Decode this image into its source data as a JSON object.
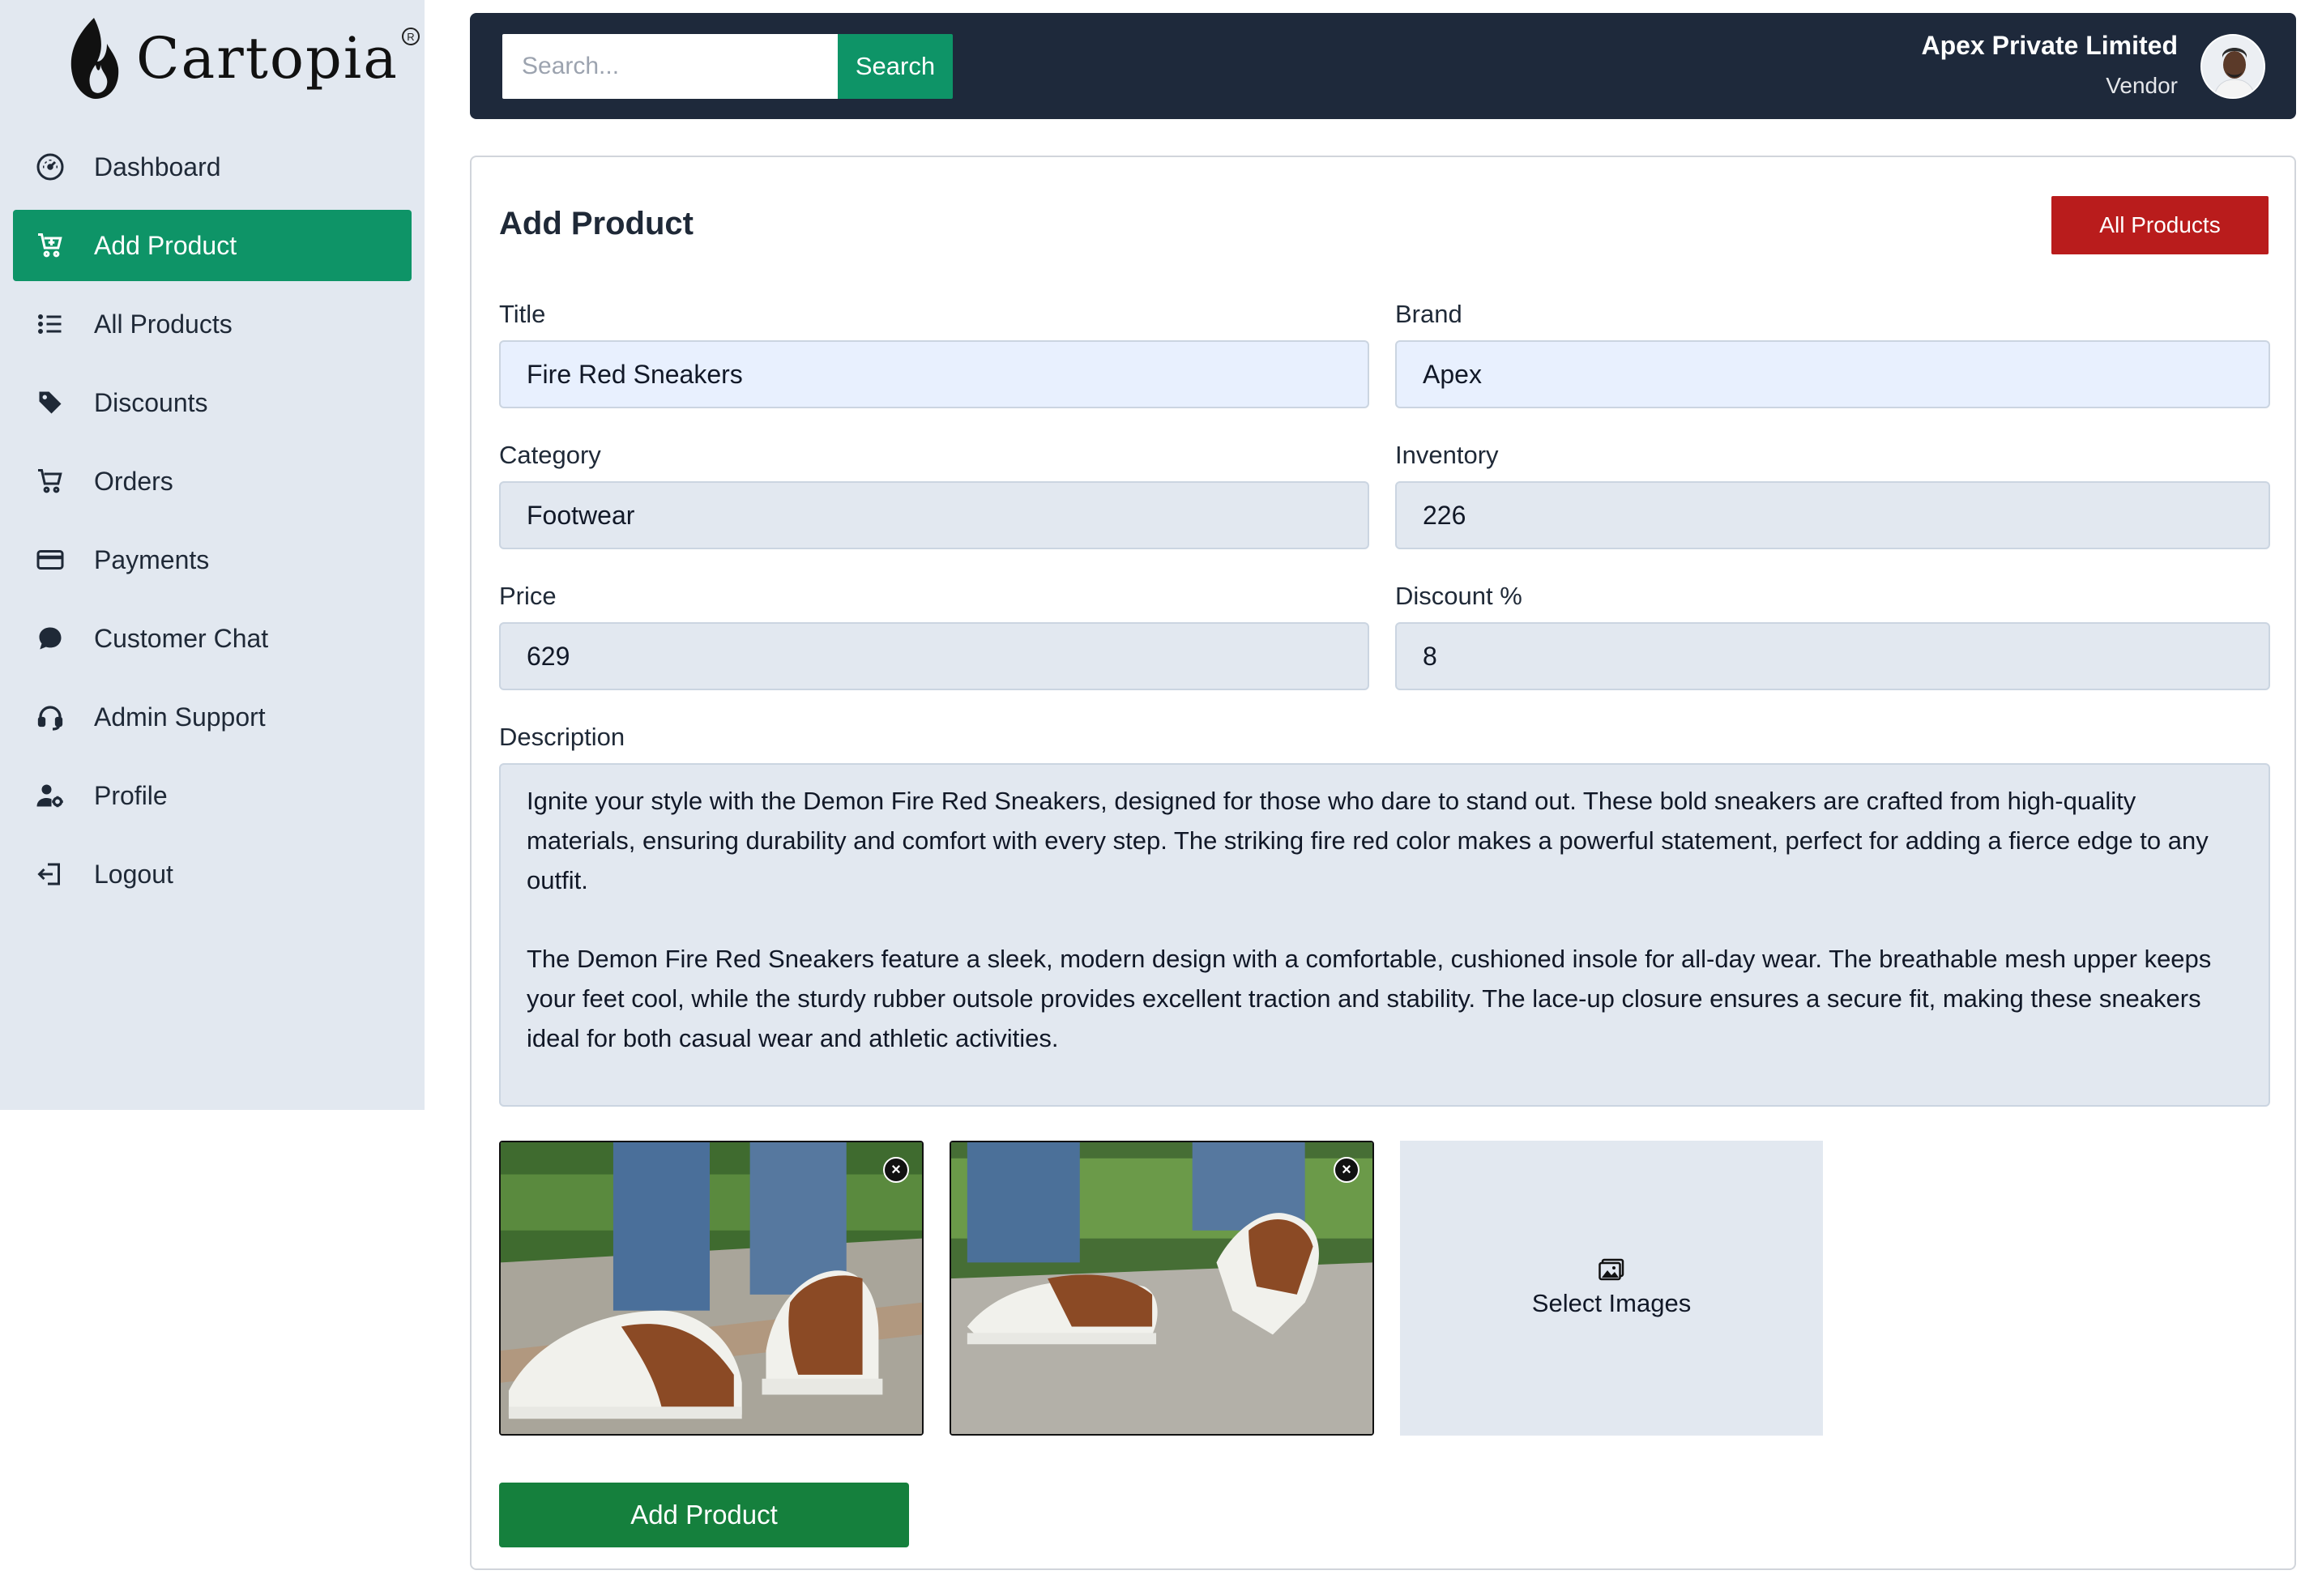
{
  "brand": {
    "name": "Cartopia",
    "reg": "R"
  },
  "sidebar": {
    "items": [
      {
        "label": "Dashboard",
        "icon": "dashboard-gauge-icon"
      },
      {
        "label": "Add Product",
        "icon": "cart-plus-icon",
        "active": true
      },
      {
        "label": "All Products",
        "icon": "list-icon"
      },
      {
        "label": "Discounts",
        "icon": "tag-icon"
      },
      {
        "label": "Orders",
        "icon": "cart-icon"
      },
      {
        "label": "Payments",
        "icon": "credit-card-icon"
      },
      {
        "label": "Customer Chat",
        "icon": "chat-bubble-icon"
      },
      {
        "label": "Admin Support",
        "icon": "headset-icon"
      },
      {
        "label": "Profile",
        "icon": "user-gear-icon"
      },
      {
        "label": "Logout",
        "icon": "logout-icon"
      }
    ]
  },
  "topbar": {
    "search_placeholder": "Search...",
    "search_button": "Search",
    "user_name": "Apex Private Limited",
    "user_role": "Vendor"
  },
  "form": {
    "title": "Add Product",
    "all_products_button": "All Products",
    "fields": {
      "title": {
        "label": "Title",
        "value": "Fire Red Sneakers"
      },
      "brand": {
        "label": "Brand",
        "value": "Apex"
      },
      "category": {
        "label": "Category",
        "value": "Footwear"
      },
      "inventory": {
        "label": "Inventory",
        "value": "226"
      },
      "price": {
        "label": "Price",
        "value": "629"
      },
      "discount": {
        "label": "Discount %",
        "value": "8"
      }
    },
    "description": {
      "label": "Description",
      "paragraph1": "Ignite your style with the Demon Fire Red Sneakers, designed for those who dare to stand out. These bold sneakers are crafted from high-quality materials, ensuring durability and comfort with every step. The striking fire red color makes a powerful statement, perfect for adding a fierce edge to any outfit.",
      "paragraph2": "The Demon Fire Red Sneakers feature a sleek, modern design with a comfortable, cushioned insole for all-day wear. The breathable mesh upper keeps your feet cool, while the sturdy rubber outsole provides excellent traction and stability. The lace-up closure ensures a secure fit, making these sneakers ideal for both casual wear and athletic activities."
    },
    "select_images": "Select Images",
    "remove_symbol": "×",
    "submit_button": "Add Product"
  },
  "colors": {
    "sidebar_bg": "#e2e8f0",
    "active_green": "#0e9467",
    "topbar_bg": "#1e293b",
    "danger_red": "#b91c1c",
    "submit_green": "#15803d"
  }
}
